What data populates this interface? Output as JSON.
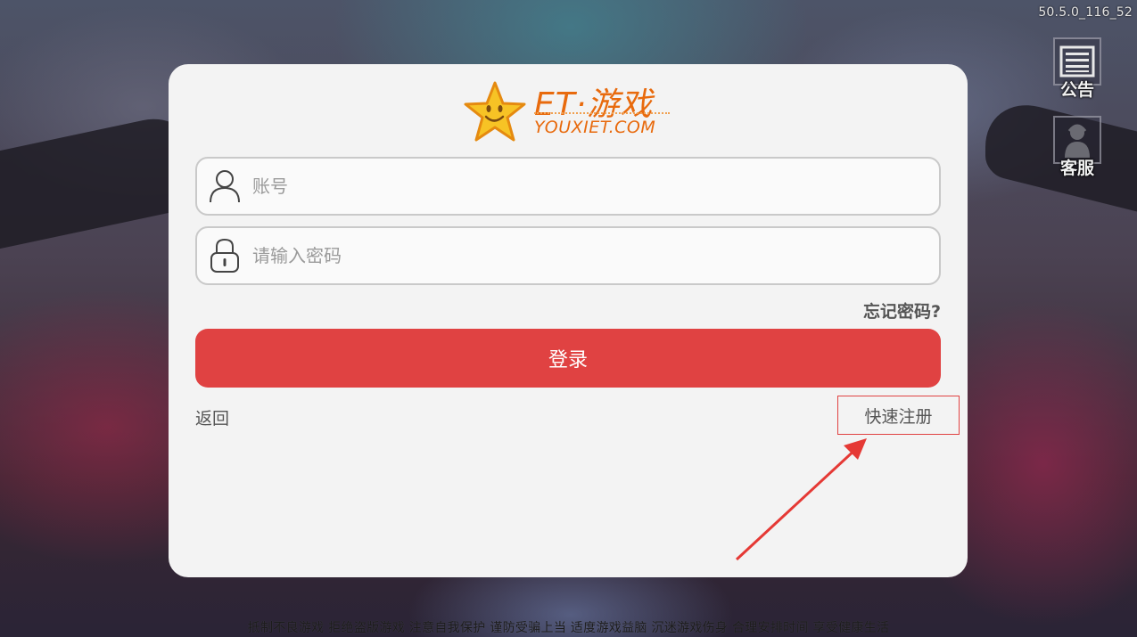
{
  "version": "50.5.0_116_52",
  "side_buttons": {
    "notice": {
      "label": "公告",
      "icon": "document-list-icon"
    },
    "service": {
      "label": "客服",
      "icon": "customer-service-icon"
    }
  },
  "logo": {
    "brand": "ET·游戏",
    "domain": "YOUXIET.COM",
    "icon": "star-smiley-icon"
  },
  "login": {
    "account_placeholder": "账号",
    "account_value": "",
    "password_placeholder": "请输入密码",
    "password_value": "",
    "forgot_label": "忘记密码?",
    "submit_label": "登录",
    "back_label": "返回",
    "register_label": "快速注册"
  },
  "colors": {
    "accent": "#e04242",
    "brand": "#e86a0d",
    "panel": "#f3f3f3"
  },
  "annotation": {
    "icon": "red-arrow-icon",
    "color": "#e53935"
  },
  "footer": "抵制不良游戏 拒绝盗版游戏 注意自我保护 谨防受骗上当 适度游戏益脑 沉迷游戏伤身 合理安排时间 享受健康生活"
}
